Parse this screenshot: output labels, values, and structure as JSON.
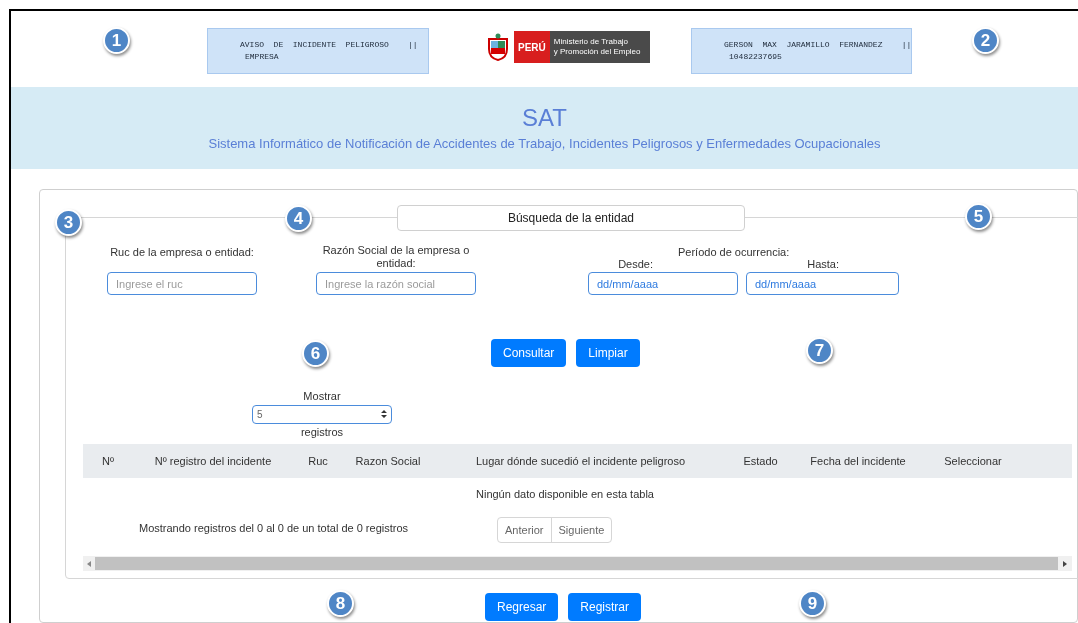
{
  "header": {
    "left_box": {
      "title": "AVISO  DE  INCIDENTE  PELIGROSO    ||",
      "subtitle": "EMPRESA"
    },
    "logo": {
      "country": "PERÚ",
      "line1": "Ministerio de Trabajo",
      "line2": "y Promoción del Empleo"
    },
    "right_box": {
      "title": "GERSON  MAX  JARAMILLO  FERNANDEZ    ||",
      "subtitle": "10482237695"
    }
  },
  "banner": {
    "title": "SAT",
    "subtitle": "Sistema Informático de Notificación de Accidentes de Trabajo, Incidentes Peligrosos y Enfermedades Ocupacionales"
  },
  "search": {
    "legend": "Búsqueda de la entidad",
    "ruc": {
      "label": "Ruc de la empresa o entidad:",
      "placeholder": "Ingrese el ruc"
    },
    "razon": {
      "label": "Razón Social de la empresa o entidad:",
      "placeholder": "Ingrese la razón social"
    },
    "period": {
      "label": "Período de ocurrencia:",
      "from_label": "Desde:",
      "from_value": "dd/mm/aaaa",
      "to_label": "Hasta:",
      "to_value": "dd/mm/aaaa"
    },
    "buttons": [
      "Consultar",
      "Limpiar"
    ]
  },
  "table": {
    "show_label": "Mostrar",
    "page_size": "5",
    "records_label": "registros",
    "columns": [
      "Nº",
      "Nº registro del incidente",
      "Ruc",
      "Razon Social",
      "Lugar dónde sucedió el incidente peligroso",
      "Estado",
      "Fecha del incidente",
      "Seleccionar"
    ],
    "empty": "Ningún dato disponible en esta tabla",
    "info": "Mostrando registros del 0 al 0 de un total de 0 registros",
    "pagination": [
      "Anterior",
      "Siguiente"
    ]
  },
  "footer_buttons": [
    "Regresar",
    "Registrar"
  ],
  "callouts": [
    "1",
    "2",
    "3",
    "4",
    "5",
    "6",
    "7",
    "8",
    "9"
  ]
}
